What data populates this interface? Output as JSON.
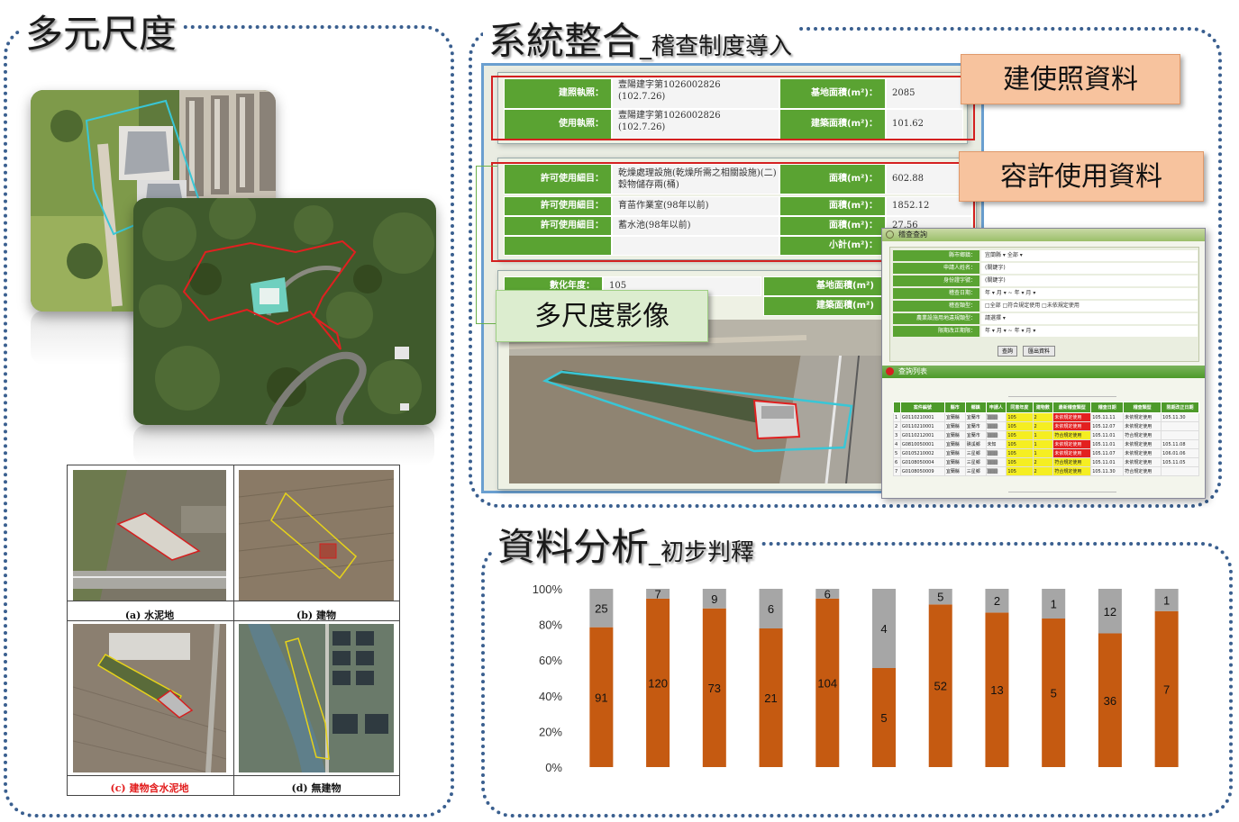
{
  "left_panel": {
    "title": "多元尺度",
    "grid": {
      "captions": [
        {
          "text": "(a)  水泥地",
          "color": "#111111"
        },
        {
          "text": "(b)  建物",
          "color": "#111111"
        },
        {
          "text": "(c)  建物含水泥地",
          "color": "#e21b1b"
        },
        {
          "text": "(d)  無建物",
          "color": "#111111"
        }
      ]
    }
  },
  "top_panel": {
    "title_main": "系統整合",
    "title_sub": "_稽查制度導入",
    "callouts": {
      "building_license": "建使照資料",
      "permit_use": "容許使用資料",
      "multi_scale": "多尺度影像"
    },
    "license_form": {
      "rows": [
        {
          "label": "建照執照：",
          "value": "壹陽建字第1026002826\n(102.7.26)",
          "area_label": "基地面積(m²)：",
          "area_value": "2085"
        },
        {
          "label": "使用執照：",
          "value": "壹陽建字第1026002826\n(102.7.26)",
          "area_label": "建築面積(m²)：",
          "area_value": "101.62"
        }
      ]
    },
    "permit_form": {
      "rows": [
        {
          "label": "許可使用細目：",
          "value": "乾燥處理設施(乾燥所需之相關設施)(二)穀物儲存兩(桶)",
          "area_label": "面積(m²)：",
          "area_value": "602.88"
        },
        {
          "label": "許可使用細目：",
          "value": "育苗作業室(98年以前)",
          "area_label": "面積(m²)：",
          "area_value": "1852.12"
        },
        {
          "label": "許可使用細目：",
          "value": "蓄水池(98年以前)",
          "area_label": "面積(m²)：",
          "area_value": "27.56"
        },
        {
          "label": "",
          "value": "",
          "area_label": "小計(m²)：",
          "area_value": ""
        }
      ]
    },
    "image_form": {
      "year_label": "數化年度：",
      "year_value": "105",
      "area_label_1": "基地面積(m²)",
      "area_label_2": "建築面積(m²)"
    },
    "query_window": {
      "title": "稽查查詢",
      "fields": [
        {
          "label": "縣市鄉鎮：",
          "value": "宜蘭縣 ▾   全部 ▾"
        },
        {
          "label": "申請人姓名：",
          "value": "(關鍵字)"
        },
        {
          "label": "身份證字號：",
          "value": "(關鍵字)"
        },
        {
          "label": "稽查日期：",
          "value": "年 ▾ 月 ▾ ~ 年 ▾ 月 ▾"
        },
        {
          "label": "稽查類型：",
          "value": "□全部 □符合規定使用 □未依規定使用"
        },
        {
          "label": "農業設施用地違規類型：",
          "value": "請選擇 ▾"
        },
        {
          "label": "限期改正期限：",
          "value": "年 ▾ 月 ▾ ~ 年 ▾ 月 ▾"
        }
      ],
      "buttons": [
        "查詢",
        "匯出資料"
      ],
      "list_title": "查詢列表",
      "table_headers": [
        "",
        "案件編號",
        "縣市",
        "鄉鎮",
        "申請人",
        "同意年度",
        "建物數",
        "最新稽查類型",
        "稽查日期",
        "稽查類型",
        "限期改正日期"
      ],
      "table_rows": [
        [
          "1",
          "G0110210001",
          "宜蘭縣",
          "宜蘭市",
          "▒▒▒",
          "105",
          "2",
          "未依規定使用",
          "105.11.11",
          "未依規定使用",
          "105.11.30"
        ],
        [
          "2",
          "G0110210001",
          "宜蘭縣",
          "宜蘭市",
          "▒▒▒",
          "105",
          "2",
          "未依規定使用",
          "105.12.07",
          "未依規定使用",
          ""
        ],
        [
          "3",
          "G0110212001",
          "宜蘭縣",
          "宜蘭市",
          "▒▒▒",
          "105",
          "1",
          "符合規定使用",
          "105.11.01",
          "符合規定使用",
          ""
        ],
        [
          "4",
          "G0810050001",
          "宜蘭縣",
          "礁溪鄉",
          "未知",
          "105",
          "1",
          "未依規定使用",
          "105.11.01",
          "未依規定使用",
          "105.11.08"
        ],
        [
          "5",
          "G0105210002",
          "宜蘭縣",
          "三星鄉",
          "▒▒▒",
          "105",
          "1",
          "未依規定使用",
          "105.11.07",
          "未依規定使用",
          "106.01.06"
        ],
        [
          "6",
          "G0108050004",
          "宜蘭縣",
          "三星鄉",
          "▒▒▒",
          "105",
          "2",
          "符合規定使用",
          "105.11.01",
          "未依規定使用",
          "105.11.05"
        ],
        [
          "7",
          "G0108050009",
          "宜蘭縣",
          "三星鄉",
          "▒▒▒",
          "105",
          "2",
          "符合規定使用",
          "105.11.30",
          "符合規定使用",
          ""
        ]
      ]
    }
  },
  "bottom_panel": {
    "title_main": "資料分析",
    "title_sub": "_初步判釋"
  },
  "colors": {
    "panel_border": "#3a5f8f",
    "form_green": "#5aa332",
    "callout_orange": "#f7c39e",
    "callout_green": "#dcedcf",
    "bar_orange": "#c55a11",
    "bar_gray": "#a6a6a6"
  },
  "chart_data": {
    "type": "bar",
    "stacked": "percent",
    "categories": [
      "",
      "",
      "",
      "",
      "",
      "",
      "",
      "",
      "",
      "",
      ""
    ],
    "series": [
      {
        "values": [
          91,
          120,
          73,
          21,
          104,
          5,
          52,
          13,
          5,
          36,
          7
        ],
        "color": "#c55a11"
      },
      {
        "values": [
          25,
          7,
          9,
          6,
          6,
          4,
          5,
          2,
          1,
          12,
          1
        ],
        "color": "#a6a6a6"
      }
    ],
    "yticks": [
      "0%",
      "20%",
      "40%",
      "60%",
      "80%",
      "100%"
    ],
    "ylim": [
      0,
      100
    ],
    "grid": false,
    "data_labels": true
  }
}
